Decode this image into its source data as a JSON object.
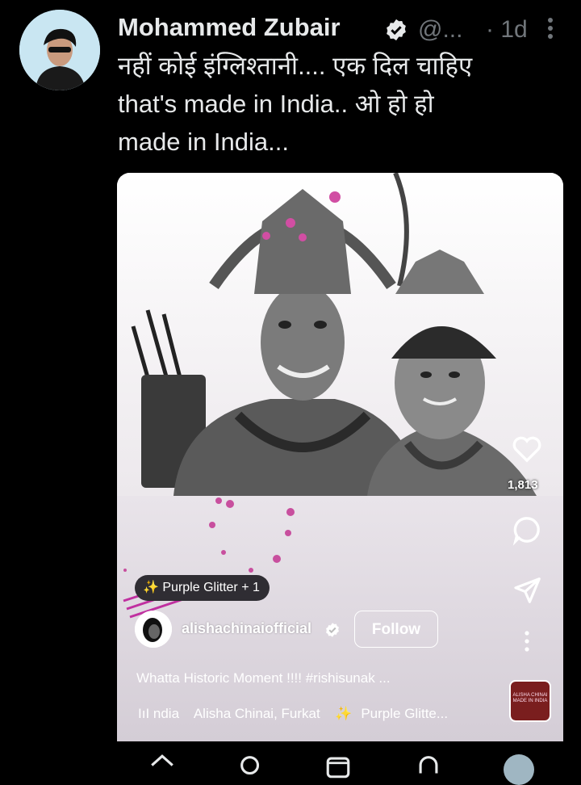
{
  "tweet": {
    "author": "Mohammed Zubair",
    "handle": "@...",
    "time": "· 1d",
    "text": "नहीं कोई इंग्लिश्तानी.... एक दिल चाहिए\nthat's made in India.. ओ हो हो\nmade in India..."
  },
  "embed": {
    "like_count": "1,813",
    "effect_chip": "Purple Glitter + 1",
    "username": "alishachinaiofficial",
    "follow_label": "Follow",
    "caption": "Whatta Historic Moment !!!! #rishisunak ...",
    "music_items": [
      "IıI ndia",
      "Alisha Chinai, Furkat",
      "Purple Glitte..."
    ],
    "thumb_label": "ALISHA CHINAI MADE IN INDIA"
  },
  "icons": {
    "verified": "verified-badge-icon",
    "more": "more-vertical-icon",
    "like": "heart-icon",
    "comment": "comment-icon",
    "share": "send-icon",
    "options": "more-vertical-icon",
    "sparkle": "sparkle-icon",
    "nav": [
      "home-icon",
      "search-icon",
      "media-icon",
      "notifications-icon",
      "profile-avatar"
    ]
  },
  "colors": {
    "background": "#000000",
    "text_primary": "#e7e9ea",
    "text_secondary": "#71767b",
    "verified_badge": "#e7e9ea"
  }
}
